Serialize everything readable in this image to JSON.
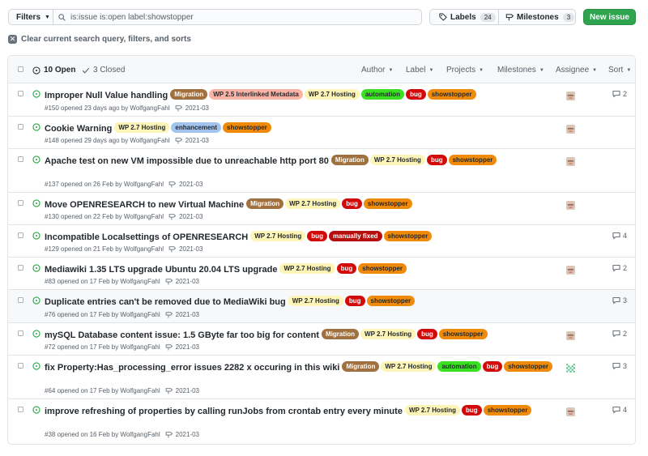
{
  "toolbar": {
    "filters_label": "Filters",
    "search_value": "is:issue is:open label:showstopper",
    "labels_label": "Labels",
    "labels_count": "24",
    "milestones_label": "Milestones",
    "milestones_count": "3",
    "new_issue_label": "New issue"
  },
  "clear_filters": "Clear current search query, filters, and sorts",
  "header": {
    "open_label": "10 Open",
    "closed_label": "3 Closed",
    "filters": [
      "Author",
      "Label",
      "Projects",
      "Milestones",
      "Assignee",
      "Sort"
    ]
  },
  "colors": {
    "open_green": "#28a745",
    "primary_button": "#2ea44f"
  },
  "label_styles": {
    "Migration": {
      "bg": "#a0703e",
      "fg": "#ffffff"
    },
    "WP 2.5 Interlinked Metadata": {
      "bg": "#f9b4a5",
      "fg": "#24292e"
    },
    "WP 2.7 Hosting": {
      "bg": "#fdf4b8",
      "fg": "#24292e"
    },
    "automation": {
      "bg": "#3be022",
      "fg": "#24292e"
    },
    "bug": {
      "bg": "#d20a0a",
      "fg": "#ffffff"
    },
    "showstopper": {
      "bg": "#ef8a0a",
      "fg": "#24292e"
    },
    "enhancement": {
      "bg": "#a2c5f0",
      "fg": "#24292e"
    },
    "manually fixed": {
      "bg": "#b60d0d",
      "fg": "#ffffff"
    }
  },
  "issues": [
    {
      "title": "Improper Null Value handling",
      "labels": [
        "Migration",
        "WP 2.5 Interlinked Metadata",
        "WP 2.7 Hosting",
        "automation",
        "bug",
        "showstopper"
      ],
      "meta": "#150 opened 23 days ago by WolfgangFahl",
      "milestone": "2021-03",
      "comments": "2",
      "avatar": "face"
    },
    {
      "title": "Cookie Warning",
      "labels": [
        "WP 2.7 Hosting",
        "enhancement",
        "showstopper"
      ],
      "meta": "#148 opened 29 days ago by WolfgangFahl",
      "milestone": "2021-03",
      "comments": "",
      "avatar": "face"
    },
    {
      "title": "Apache test on new VM impossible due to unreachable http port 80",
      "labels": [
        "Migration",
        "WP 2.7 Hosting",
        "bug",
        "showstopper"
      ],
      "meta": "#137 opened on 26 Feb by WolfgangFahl",
      "milestone": "2021-03",
      "comments": "",
      "avatar": "face"
    },
    {
      "title": "Move OPENRESEARCH to new Virtual Machine",
      "labels": [
        "Migration",
        "WP 2.7 Hosting",
        "bug",
        "showstopper"
      ],
      "meta": "#130 opened on 22 Feb by WolfgangFahl",
      "milestone": "2021-03",
      "comments": "",
      "avatar": "face"
    },
    {
      "title": "Incompatible Localsettings of OPENRESEARCH",
      "labels": [
        "WP 2.7 Hosting",
        "bug",
        "manually fixed",
        "showstopper"
      ],
      "meta": "#129 opened on 21 Feb by WolfgangFahl",
      "milestone": "2021-03",
      "comments": "4",
      "avatar": ""
    },
    {
      "title": "Mediawiki 1.35 LTS upgrade Ubuntu 20.04 LTS upgrade",
      "labels": [
        "WP 2.7 Hosting",
        "bug",
        "showstopper"
      ],
      "meta": "#83 opened on 17 Feb by WolfgangFahl",
      "milestone": "2021-03",
      "comments": "2",
      "avatar": "face"
    },
    {
      "title": "Duplicate entries can't be removed due to MediaWiki bug",
      "labels": [
        "WP 2.7 Hosting",
        "bug",
        "showstopper"
      ],
      "meta": "#76 opened on 17 Feb by WolfgangFahl",
      "milestone": "2021-03",
      "comments": "3",
      "avatar": ""
    },
    {
      "title": "mySQL Database content issue: 1.5 GByte far too big for content",
      "labels": [
        "Migration",
        "WP 2.7 Hosting",
        "bug",
        "showstopper"
      ],
      "meta": "#72 opened on 17 Feb by WolfgangFahl",
      "milestone": "2021-03",
      "comments": "2",
      "avatar": "face"
    },
    {
      "title": "fix Property:Has_processing_error issues 2282 x occuring in this wiki",
      "labels": [
        "Migration",
        "WP 2.7 Hosting",
        "automation",
        "bug",
        "showstopper"
      ],
      "meta": "#64 opened on 17 Feb by WolfgangFahl",
      "milestone": "2021-03",
      "comments": "3",
      "avatar": "pixel"
    },
    {
      "title": "improve refreshing of properties by calling runJobs from crontab entry every minute",
      "labels": [
        "WP 2.7 Hosting",
        "bug",
        "showstopper"
      ],
      "meta": "#38 opened on 16 Feb by WolfgangFahl",
      "milestone": "2021-03",
      "comments": "4",
      "avatar": "face"
    }
  ]
}
